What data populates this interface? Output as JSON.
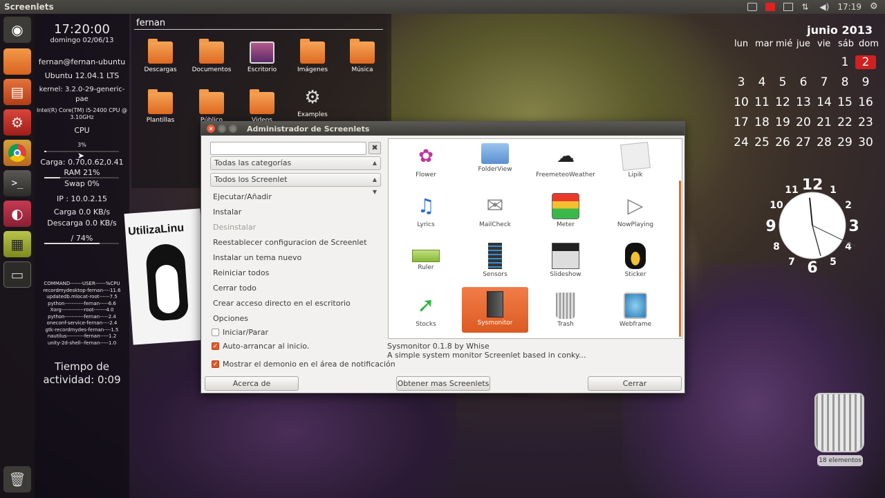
{
  "topbar": {
    "title": "Screenlets",
    "time": "17:19"
  },
  "launcher": {
    "items": [
      "ubuntu-logo-icon",
      "files-icon",
      "software-center-icon",
      "settings-icon",
      "chrome-icon",
      "terminal-icon",
      "screenlets-app-icon",
      "calendar-clock-icon",
      "window-icon",
      "trash-icon"
    ]
  },
  "sysinfo": {
    "time": "17:20:00",
    "date": "domingo 02/06/13",
    "user": "fernan@fernan-ubuntu",
    "os": "Ubuntu 12.04.1 LTS",
    "kernel1": "kernel: 3.2.0-29-generic-",
    "kernel2": "pae",
    "cpu_model1": "Intel(R) Core(TM) i5-2400 CPU @",
    "cpu_model2": "3.10GHz",
    "cpu_label": "CPU",
    "cpu_pct": "3%",
    "load": "Carga: 0.70,0.62,0.41",
    "ram": "RAM 21%",
    "swap": "Swap 0%",
    "ip": "IP : 10.0.2.15",
    "up": "Carga 0.0 KB/s",
    "down": "Descarga 0.0 KB/s",
    "disk": "/ 74%",
    "procs": [
      "COMMAND-------USER------%CPU",
      "recordmydesktop-fernan----11.6",
      "updatedb.mlocat-root------7.5",
      "python-----------fernan-----6.6",
      "Xorg-------------root-------4.0",
      "python-----------fernan-----2.4",
      "oneconf-service-fernan----2.4",
      "gtk-recordmydes-fernan----1.5",
      "nautilus----------fernan-----1.2",
      "unity-2d-shell--fernan-----1.0"
    ],
    "uptime1": "Tiempo de",
    "uptime2": "actividad: 0:09"
  },
  "folderview": {
    "title": "fernan",
    "items": [
      "Descargas",
      "Documentos",
      "Escritorio",
      "Imágenes",
      "Música",
      "Plantillas",
      "Público",
      "Videos",
      "Examples"
    ]
  },
  "sticker_text": "UtilizaLinu",
  "dialog": {
    "title": "Administrador de Screenlets",
    "search_value": "",
    "clear_icon": "✖",
    "category_combo": "Todas las categorías",
    "filter_combo": "Todos los Screenlet",
    "actions": [
      "Ejecutar/Añadir",
      "Instalar",
      "Desinstalar",
      "Reestablecer configuracion de Screenlet",
      "Instalar un tema nuevo",
      "Reiniciar todos",
      "Cerrar todo",
      "Crear acceso directo en el escritorio",
      "Opciones"
    ],
    "checks": {
      "start_stop": "Iniciar/Parar",
      "autostart": "Auto-arrancar al inicio.",
      "tray": "Mostrar el demonio en el área de notificación"
    },
    "screenlets": [
      "Flower",
      "FolderView",
      "FreemeteoWeather",
      "Lipik",
      "Lyrics",
      "MailCheck",
      "Meter",
      "NowPlaying",
      "Ruler",
      "Sensors",
      "Slideshow",
      "Sticker",
      "Stocks",
      "Sysmonitor",
      "Trash",
      "Webframe"
    ],
    "selected": "Sysmonitor",
    "desc_title": "Sysmonitor 0.1.8 by Whise",
    "desc_body": "A simple system monitor Screenlet based in conky...",
    "btn_about": "Acerca de",
    "btn_more": "Obtener mas Screenlets",
    "btn_close": "Cerrar",
    "accent": "#e2662e"
  },
  "calendar": {
    "month": "junio 2013",
    "dows": [
      "lun",
      "mar",
      "mié",
      "jue",
      "vie",
      "sáb",
      "dom"
    ],
    "today": "2",
    "rows": [
      [
        "",
        "",
        "",
        "",
        "",
        "1",
        "2"
      ],
      [
        "3",
        "4",
        "5",
        "6",
        "7",
        "8",
        "9"
      ],
      [
        "10",
        "11",
        "12",
        "13",
        "14",
        "15",
        "16"
      ],
      [
        "17",
        "18",
        "19",
        "20",
        "21",
        "22",
        "23"
      ],
      [
        "24",
        "25",
        "26",
        "27",
        "28",
        "29",
        "30"
      ]
    ]
  },
  "clock": {
    "numbers": [
      "12",
      "1",
      "2",
      "3",
      "4",
      "5",
      "6",
      "7",
      "8",
      "9",
      "10",
      "11"
    ]
  },
  "trash": {
    "label": "18 elementos"
  }
}
